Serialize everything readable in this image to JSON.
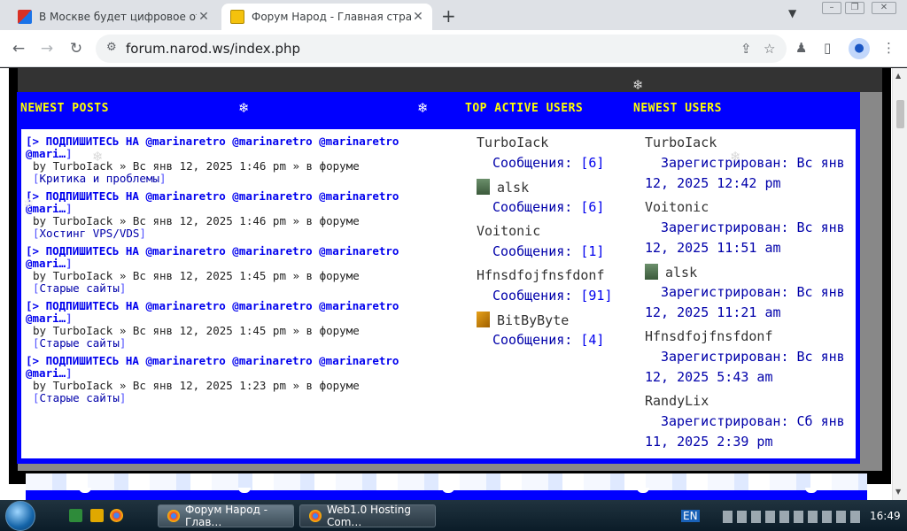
{
  "browser": {
    "tabs": [
      {
        "title": "В Москве будет цифровое отс",
        "favicon": "rg-ru-icon",
        "active": false
      },
      {
        "title": "Форум Народ - Главная стран",
        "favicon": "smiley-icon",
        "active": true
      }
    ],
    "new_tab_label": "+",
    "url": "forum.narod.ws/index.php"
  },
  "forum": {
    "headers": {
      "newest_posts": "NEWEST POSTS",
      "top_active_users": "TOP ACTIVE USERS",
      "newest_users": "NEWEST USERS"
    },
    "posts": [
      {
        "bracket_open": "[>",
        "title": "ПОДПИШИТЕСЬ НА @marinaretro @marinaretro @marinaretro @mari…",
        "bracket_close": "]",
        "by": "by TurboIack » Вс янв 12, 2025 1:46 pm » в форуме",
        "forum": "Критика и проблемы"
      },
      {
        "bracket_open": "[>",
        "title": "ПОДПИШИТЕСЬ НА @marinaretro @marinaretro @marinaretro @mari…",
        "bracket_close": "]",
        "by": "by TurboIack » Вс янв 12, 2025 1:46 pm » в форуме",
        "forum": "Хостинг VPS/VDS"
      },
      {
        "bracket_open": "[>",
        "title": "ПОДПИШИТЕСЬ НА @marinaretro @marinaretro @marinaretro @mari…",
        "bracket_close": "]",
        "by": "by TurboIack » Вс янв 12, 2025 1:45 pm » в форуме",
        "forum": "Старые сайты"
      },
      {
        "bracket_open": "[>",
        "title": "ПОДПИШИТЕСЬ НА @marinaretro @marinaretro @marinaretro @mari…",
        "bracket_close": "]",
        "by": "by TurboIack » Вс янв 12, 2025 1:45 pm » в форуме",
        "forum": "Старые сайты"
      },
      {
        "bracket_open": "[>",
        "title": "ПОДПИШИТЕСЬ НА @marinaretro @marinaretro @marinaretro @mari…",
        "bracket_close": "]",
        "by": "by TurboIack » Вс янв 12, 2025 1:23 pm » в форуме",
        "forum": "Старые сайты"
      }
    ],
    "posts_label": "Сообщения:",
    "active_users": [
      {
        "name": "TurboIack",
        "posts": "6",
        "avatar": ""
      },
      {
        "name": "alsk",
        "posts": "6",
        "avatar": "alsk-avatar-icon"
      },
      {
        "name": "Voitonic",
        "posts": "1",
        "avatar": ""
      },
      {
        "name": "Hfnsdfojfnsfdonf",
        "posts": "91",
        "avatar": ""
      },
      {
        "name": "BitByByte",
        "posts": "4",
        "avatar": "bitbybyte-avatar-icon"
      }
    ],
    "newest_users": [
      {
        "name": "TurboIack",
        "registered": "Зарегистрирован: Вс янв 12, 2025 12:42 pm",
        "avatar": ""
      },
      {
        "name": "Voitonic",
        "registered": "Зарегистрирован: Вс янв 12, 2025 11:51 am",
        "avatar": ""
      },
      {
        "name": "alsk",
        "registered": "Зарегистрирован: Вс янв 12, 2025 11:21 am",
        "avatar": "alsk-avatar-icon"
      },
      {
        "name": "Hfnsdfojfnsfdonf",
        "registered": "Зарегистрирован: Вс янв 12, 2025 5:43 am",
        "avatar": ""
      },
      {
        "name": "RandyLix",
        "registered": "Зарегистрирован: Сб янв 11, 2025 2:39 pm",
        "avatar": ""
      }
    ]
  },
  "taskbar": {
    "buttons": [
      {
        "label": "Форум Народ - Глав…",
        "active": true
      },
      {
        "label": "Web1.0 Hosting Com…",
        "active": false
      }
    ],
    "language": "EN",
    "clock": "16:49"
  },
  "colors": {
    "panel_blue": "#0000ff",
    "header_yellow": "#ffff00",
    "link_blue": "#0000ee",
    "dark_blue_text": "#0000aa"
  }
}
